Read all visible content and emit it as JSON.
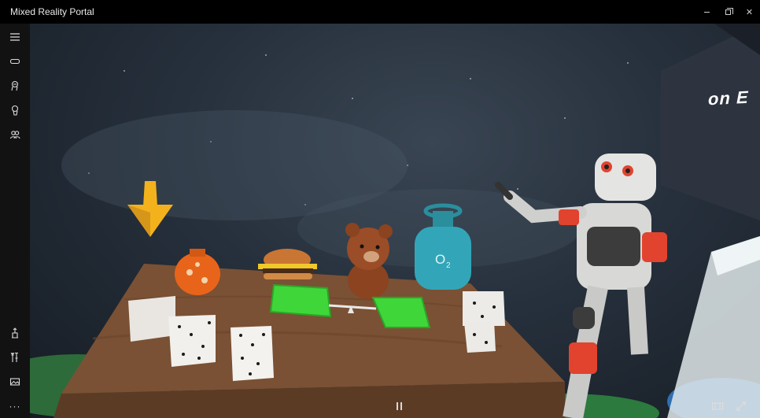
{
  "window": {
    "title": "Mixed Reality Portal",
    "controls": [
      "minimize-icon",
      "restore-icon",
      "close-icon"
    ],
    "close_glyph": "✕"
  },
  "sidebar": {
    "top_items": [
      "menu-icon",
      "headset-icon",
      "motion-controller-icon",
      "controller-setup-icon",
      "people-icon"
    ],
    "bottom_items": [
      "app-launcher-icon",
      "settings-tools-icon",
      "photo-icon"
    ],
    "more_glyph": "···"
  },
  "scene": {
    "billboard_text": "on E",
    "tank_label": "O",
    "tank_subscript": "2"
  },
  "playback": {
    "pause_icon": "pause-icon",
    "view_mode_icon": "window-view-icon",
    "fullscreen_icon": "expand-icon"
  },
  "colors": {
    "titlebar": "#000000",
    "sidebar": "#121212",
    "table": "#7a5134",
    "scale_tray": "#3fd63a",
    "cone": "#f3b21c",
    "gas_tank": "#32a6b8",
    "robot_accent": "#e2432e"
  }
}
